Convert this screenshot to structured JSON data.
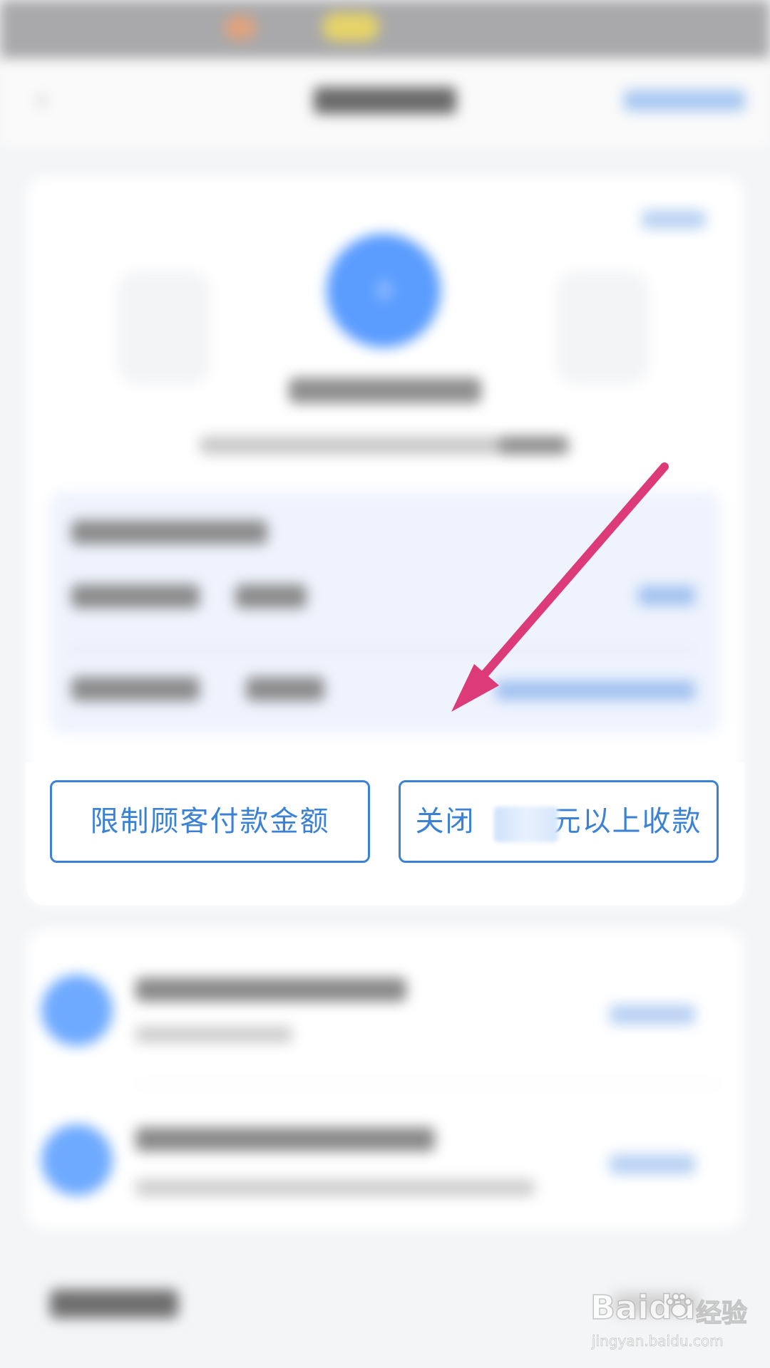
{
  "buttons": {
    "limit_label": "限制顾客付款金额",
    "close_prefix": "关闭",
    "close_suffix": "元以上收款"
  },
  "watermark": {
    "logo": "Baidu",
    "suffix": "经验",
    "url": "jingyan.baidu.com"
  },
  "colors": {
    "accent": "#3b82d6",
    "annotation_arrow": "#dc3a78"
  },
  "icons": {
    "annotation": "arrow-down-left-icon",
    "watermark": "baidu-paw-icon"
  }
}
